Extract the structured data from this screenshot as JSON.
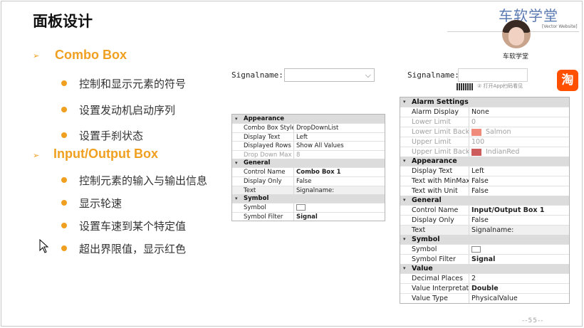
{
  "slide": {
    "title": "面板设计",
    "brand": "车软学堂",
    "brand_sub": "[Vector Website]",
    "avatar_caption": "车软学堂",
    "page_number": "--55--"
  },
  "sections": [
    {
      "heading": "Combo Box",
      "bullets": [
        "控制和显示元素的符号",
        "设置发动机启动序列",
        "设置手刹状态"
      ]
    },
    {
      "heading": "Input/Output Box",
      "bullets": [
        "控制元素的输入与输出信息",
        "显示轮速",
        "设置车速到某个特定值",
        "超出界限值，显示红色"
      ]
    }
  ],
  "combo_preview": {
    "label": "Signalname:",
    "value": ""
  },
  "io_preview": {
    "label": "Signalname:",
    "value": ""
  },
  "watermark": {
    "hint": "② 打开App扫码看见",
    "app_icon": "淘"
  },
  "combo_props": {
    "sections": [
      {
        "name": "Appearance",
        "rows": [
          {
            "key": "Combo Box Style",
            "value": "DropDownList"
          },
          {
            "key": "Display Text",
            "value": "Left"
          },
          {
            "key": "Displayed Rows",
            "value": "Show  All Values"
          },
          {
            "key": "Drop Down Max Iter",
            "value": "8",
            "dim": true
          }
        ]
      },
      {
        "name": "General",
        "rows": [
          {
            "key": "Control Name",
            "value": "Combo Box 1",
            "bold": true
          },
          {
            "key": "Display Only",
            "value": "False"
          },
          {
            "key": "Text",
            "value": "Signalname:",
            "highlight": true
          }
        ]
      },
      {
        "name": "Symbol",
        "rows": [
          {
            "key": "Symbol",
            "value": "",
            "checkbox": true
          },
          {
            "key": "Symbol Filter",
            "value": "Signal",
            "bold": true
          }
        ]
      }
    ]
  },
  "io_props": {
    "sections": [
      {
        "name": "Alarm Settings",
        "rows": [
          {
            "key": "Alarm Display",
            "value": "None"
          },
          {
            "key": "Lower Limit",
            "value": "0",
            "dim": true
          },
          {
            "key": "Lower Limit Backgro",
            "value": "Salmon",
            "dim": true,
            "swatch": "#f08a7a"
          },
          {
            "key": "Upper Limit",
            "value": "100",
            "dim": true
          },
          {
            "key": "Upper Limit Backgro",
            "value": "IndianRed",
            "dim": true,
            "swatch": "#cd5c5c"
          }
        ]
      },
      {
        "name": "Appearance",
        "rows": [
          {
            "key": "Display Text",
            "value": "Left"
          },
          {
            "key": "Text with MinMax Va",
            "value": "False"
          },
          {
            "key": "Text with Unit",
            "value": "False"
          }
        ]
      },
      {
        "name": "General",
        "rows": [
          {
            "key": "Control Name",
            "value": "Input/Output Box 1",
            "bold": true
          },
          {
            "key": "Display Only",
            "value": "False"
          },
          {
            "key": "Text",
            "value": "Signalname:",
            "highlight": true
          }
        ]
      },
      {
        "name": "Symbol",
        "rows": [
          {
            "key": "Symbol",
            "value": "",
            "checkbox": true
          },
          {
            "key": "Symbol Filter",
            "value": "Signal",
            "bold": true
          }
        ]
      },
      {
        "name": "Value",
        "rows": [
          {
            "key": "Decimal Places",
            "value": "2"
          },
          {
            "key": "Value Interpretation",
            "value": "Double",
            "bold": true
          },
          {
            "key": "Value Type",
            "value": "PhysicalValue"
          }
        ]
      }
    ]
  },
  "colors": {
    "accent": "#f0a020",
    "brand": "#5b7bb3",
    "salmon": "#f08a7a",
    "indianred": "#cd5c5c"
  }
}
